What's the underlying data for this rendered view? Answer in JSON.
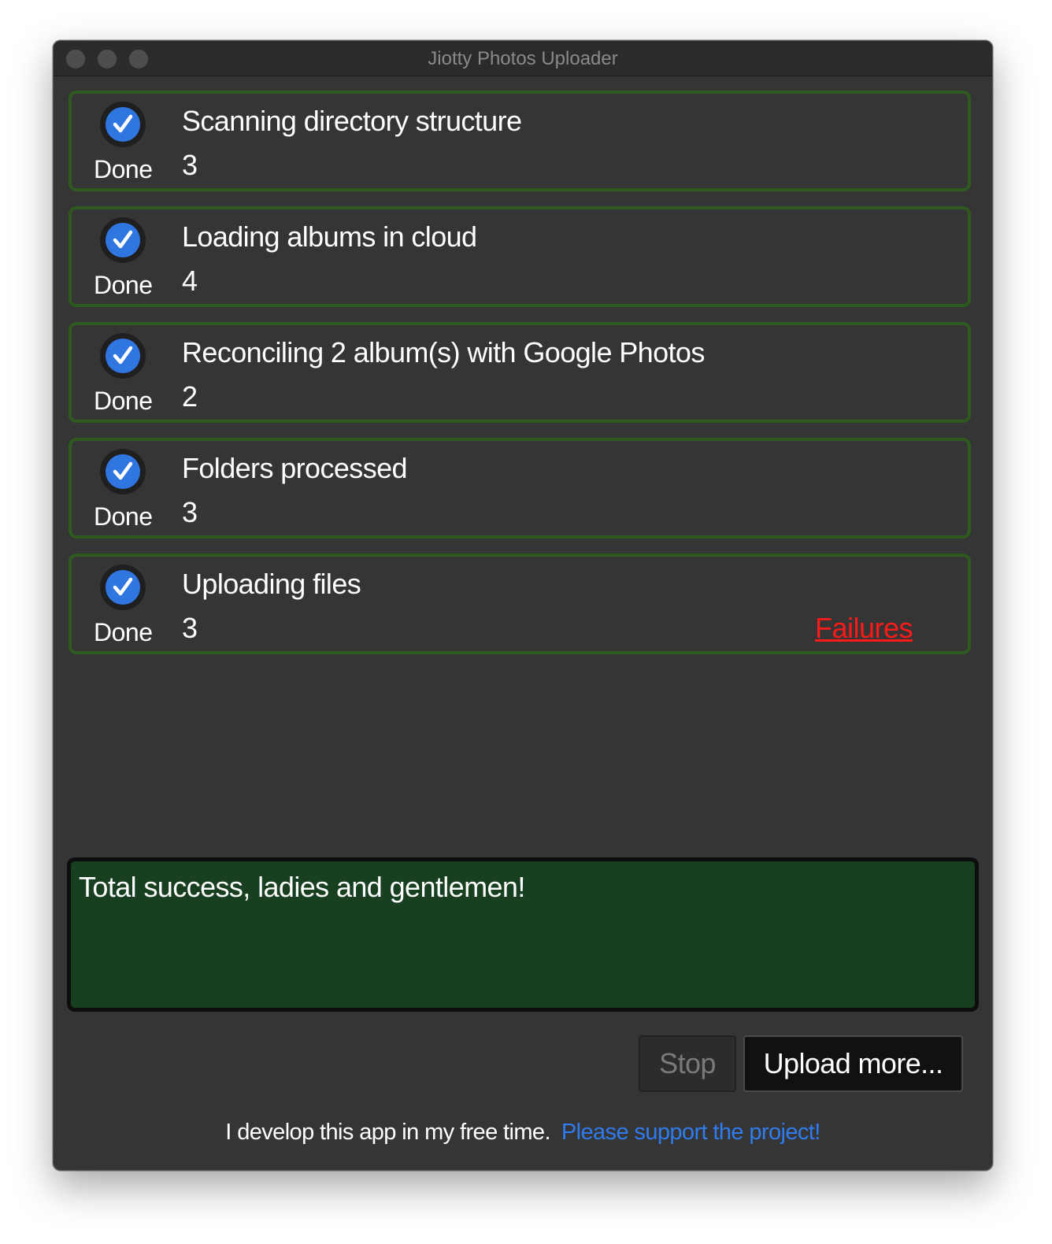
{
  "window": {
    "title": "Jiotty Photos Uploader"
  },
  "steps": [
    {
      "title": "Scanning directory structure",
      "count": "3",
      "status": "Done",
      "icon": "checkmark-icon"
    },
    {
      "title": "Loading albums in cloud",
      "count": "4",
      "status": "Done",
      "icon": "checkmark-icon"
    },
    {
      "title": "Reconciling 2 album(s) with Google Photos",
      "count": "2",
      "status": "Done",
      "icon": "checkmark-icon"
    },
    {
      "title": "Folders processed",
      "count": "3",
      "status": "Done",
      "icon": "checkmark-icon"
    },
    {
      "title": "Uploading files",
      "count": "3",
      "status": "Done",
      "icon": "checkmark-icon",
      "failures_link": "Failures"
    }
  ],
  "message": {
    "text": "Total success, ladies and gentlemen!"
  },
  "buttons": {
    "stop_label": "Stop",
    "upload_more_label": "Upload more..."
  },
  "footer": {
    "text": "I develop this app in my free time.",
    "link": "Please support the project!"
  },
  "colors": {
    "accent_blue": "#2f76e0",
    "step_border_green": "#2f5a1f",
    "message_bg": "#173f20",
    "failure_red": "#ff1a1a",
    "link_blue": "#2f7cf0"
  }
}
